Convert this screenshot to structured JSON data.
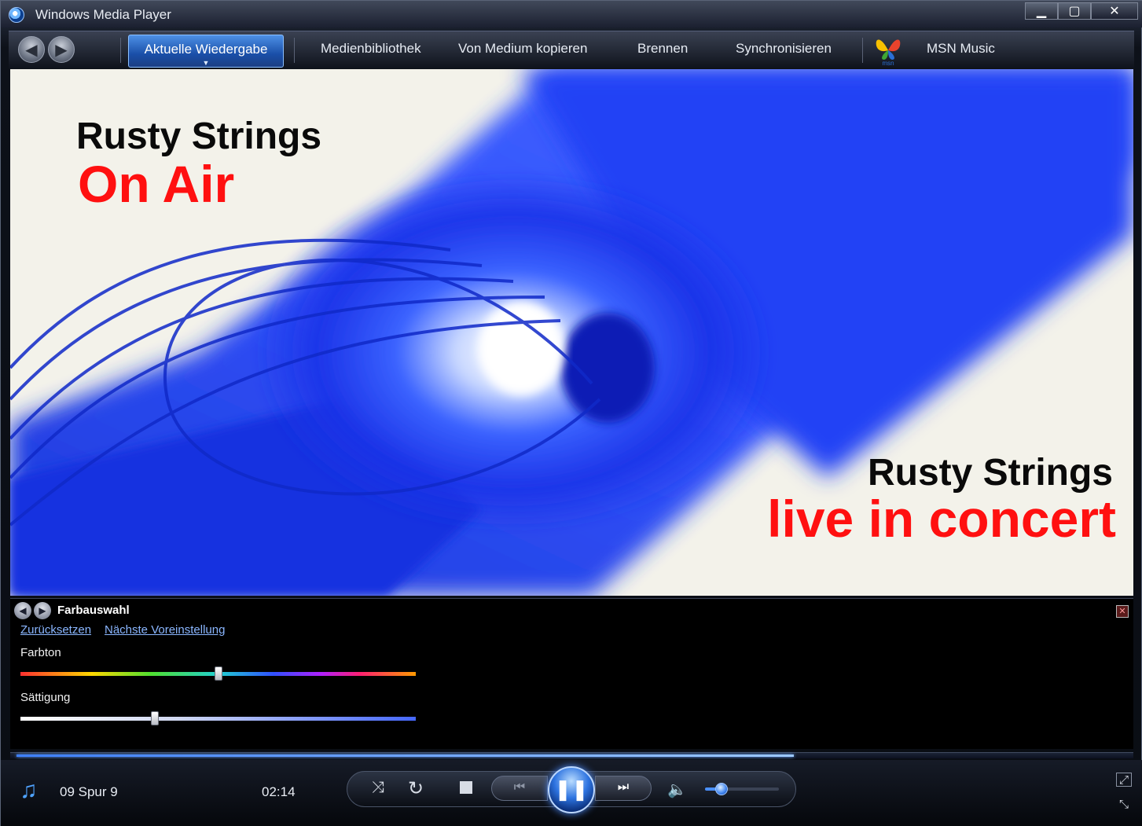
{
  "window": {
    "title": "Windows Media Player",
    "controls": {
      "minimize": "▁",
      "maximize": "▢",
      "close": "✕"
    }
  },
  "nav": {
    "back_icon": "◀",
    "forward_icon": "▶",
    "tabs": [
      {
        "label": "Aktuelle Wiedergabe",
        "active": true
      },
      {
        "label": "Medienbibliothek"
      },
      {
        "label": "Von Medium kopieren"
      },
      {
        "label": "Brennen"
      },
      {
        "label": "Synchronisieren"
      },
      {
        "label": "MSN Music"
      }
    ],
    "msn_logo_text": "msn"
  },
  "video": {
    "overlay_top": {
      "line1": "Rusty Strings",
      "line2": "On Air"
    },
    "overlay_bottom": {
      "line1": "Rusty Strings",
      "line2": "live in concert"
    }
  },
  "panel": {
    "title": "Farbauswahl",
    "close": "✕",
    "links": {
      "reset": "Zurücksetzen",
      "next_preset": "Nächste Voreinstellung"
    },
    "hue": {
      "label": "Farbton",
      "value_fraction": 0.5
    },
    "saturation": {
      "label": "Sättigung",
      "value_fraction": 0.34
    }
  },
  "playback": {
    "track": "09 Spur 9",
    "time": "02:14",
    "progress_fraction": 0.7,
    "volume_fraction": 0.22
  },
  "colors": {
    "accent": "#2d73e0",
    "overlay_red": "#ff1010",
    "visual_blue": "#1a3cff"
  }
}
